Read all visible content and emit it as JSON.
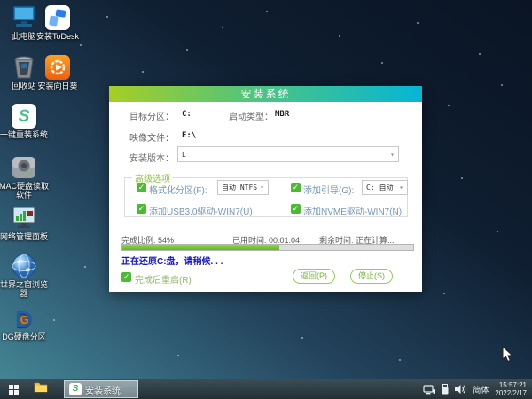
{
  "desktop": {
    "icons": [
      {
        "name": "this-pc",
        "label": "此电脑"
      },
      {
        "name": "install-todesk",
        "label": "安装ToDesk"
      },
      {
        "name": "recycle-bin",
        "label": "回收站"
      },
      {
        "name": "install-sunflower",
        "label": "安装向日葵"
      },
      {
        "name": "one-click-reinstall",
        "label": "一键重装系统"
      },
      {
        "name": "mac-disk-reader",
        "label": "MAC硬盘读取软件"
      },
      {
        "name": "network-panel",
        "label": "网络管理面板"
      },
      {
        "name": "world-window-browser",
        "label": "世界之窗浏览器"
      },
      {
        "name": "dg-partition",
        "label": "DG硬盘分区"
      }
    ]
  },
  "dialog": {
    "title": "安装系统",
    "fields": {
      "target_partition_label": "目标分区：",
      "target_partition_value": "C:",
      "boot_type_label": "启动类型：",
      "boot_type_value": "MBR",
      "image_file_label": "映像文件：",
      "image_file_value": "E:\\",
      "install_version_label": "安装版本：",
      "install_version_value": "L"
    },
    "advanced": {
      "legend": "高级选项",
      "format_label": "格式化分区(F):",
      "format_value": "自动 NTFS",
      "boot_label": "添加引导(G):",
      "boot_value": "C: 自动",
      "usb_label": "添加USB3.0驱动-WIN7(U)",
      "nvme_label": "添加NVME驱动-WIN7(N)"
    },
    "progress": {
      "percent": 54,
      "percent_label": "完成比例: 54%",
      "elapsed_label": "已用时间: 00:01:04",
      "remaining_label": "剩余时间: 正在计算...",
      "status_text": "正在还原C:盘，请稍候. . .",
      "restart_label": "完成后重启(R)"
    },
    "buttons": {
      "back": "返回(P)",
      "stop": "停止(S)"
    }
  },
  "taskbar": {
    "app_label": "安装系统",
    "app_icon_glyph": "S",
    "tray": {
      "input_indicator": "简体",
      "time": "15:57:21",
      "date": "2022/2/17"
    }
  },
  "ui": {
    "check_glyph": "✓",
    "caret_glyph": "▾",
    "colors": {
      "title_gradient_left": "#a6ce24",
      "title_gradient_right": "#05b6d6",
      "accent_green": "#4cbb33",
      "progress_fill": "#6fc52f",
      "status_blue": "#1414cc"
    }
  }
}
